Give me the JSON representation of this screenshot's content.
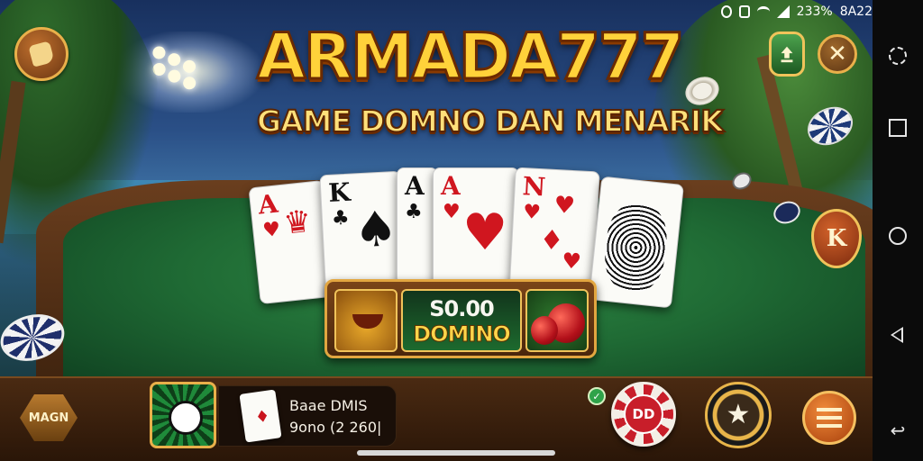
{
  "game": {
    "title": "ARMADA777",
    "subtitle": "GAME DOMNO DAN MENARIK"
  },
  "status_bar": {
    "battery": "233%",
    "time": "8A22"
  },
  "cards": [
    {
      "rank": "A",
      "suit": "♥",
      "color": "red"
    },
    {
      "rank": "K",
      "suit": "♣",
      "color": "black"
    },
    {
      "rank": "A",
      "suit": "♣",
      "color": "black"
    },
    {
      "rank": "A",
      "suit": "♥",
      "color": "red"
    },
    {
      "rank": "N",
      "suit": "♥",
      "color": "red"
    },
    {
      "rank": "",
      "suit": "",
      "color": "black"
    }
  ],
  "slot": {
    "amount": "S0.00",
    "label": "DOMINO"
  },
  "right_side": {
    "k_button_label": "K"
  },
  "bottom": {
    "hex_button_label": "MAGN",
    "info_line1": "Baae DMIS",
    "info_line2": "9ono (2 260|",
    "chip_button_label": "DD",
    "star_icon": "★"
  },
  "nav": {
    "return_glyph": "↩"
  },
  "colors": {
    "title_gold": "#ffd23a",
    "felt_green": "#1f6a34",
    "wood_brown": "#4a2a12",
    "gold_trim": "#e9b04a",
    "card_red": "#d0161f"
  },
  "icons": [
    "home-badge-icon",
    "upload-icon",
    "close-icon",
    "k-icon",
    "star-icon",
    "menu-icon",
    "rotate-icon",
    "recents-icon",
    "home-icon",
    "back-icon",
    "return-icon"
  ]
}
